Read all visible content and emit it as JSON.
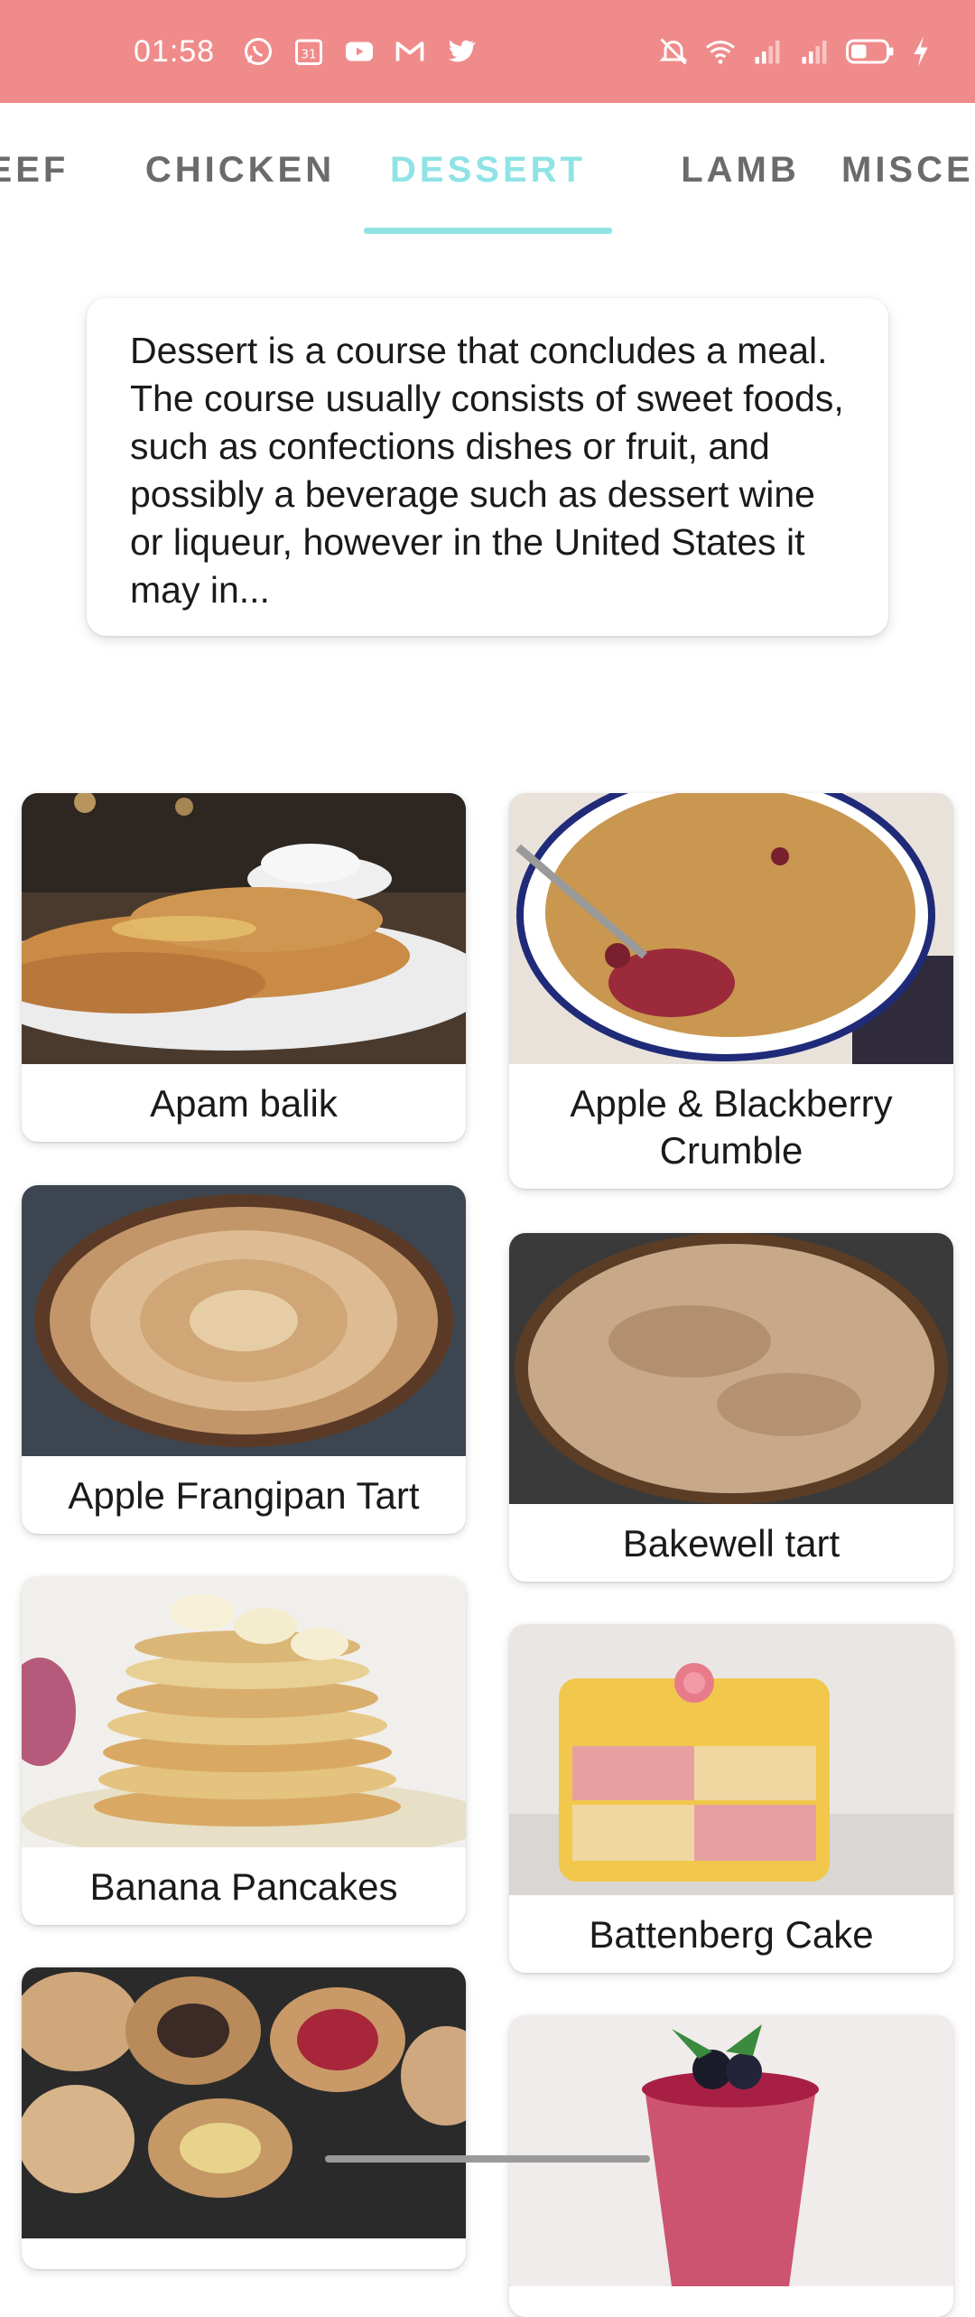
{
  "status_bar": {
    "time": "01:58",
    "background": "#f08b8b",
    "left_icons": [
      "whatsapp-icon",
      "calendar-icon",
      "youtube-icon",
      "gmail-icon",
      "twitter-icon"
    ],
    "right_icons": [
      "mute-icon",
      "wifi-icon",
      "signal-icon",
      "signal-icon",
      "battery-icon",
      "charging-icon"
    ]
  },
  "tabs": {
    "items": [
      "BEEF",
      "CHICKEN",
      "DESSERT",
      "LAMB",
      "MISCELLANEOUS"
    ],
    "active": "DESSERT",
    "active_color": "#8fe3e5"
  },
  "description": "Dessert is a course that concludes a meal. The course usually consists of sweet foods, such as confections dishes or fruit, and possibly a beverage such as dessert wine or liqueur, however in the United States it may in...",
  "meals": [
    {
      "name": "Apam balik"
    },
    {
      "name": "Apple & Blackberry Crumble"
    },
    {
      "name": "Apple Frangipan Tart"
    },
    {
      "name": "Bakewell tart"
    },
    {
      "name": "Banana Pancakes"
    },
    {
      "name": "Battenberg Cake"
    },
    {
      "name": ""
    },
    {
      "name": ""
    }
  ]
}
